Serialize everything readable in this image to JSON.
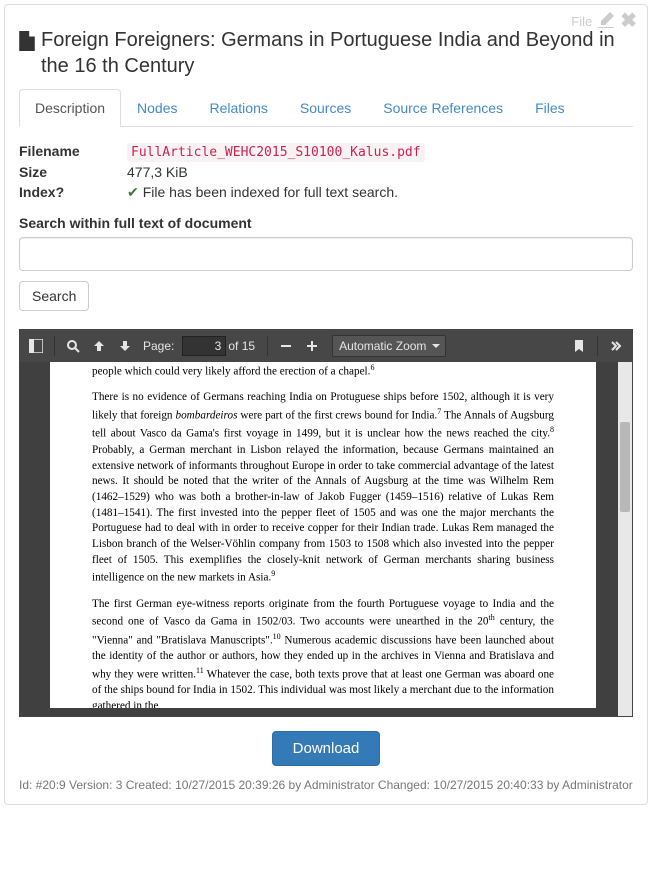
{
  "top": {
    "file_label": "File"
  },
  "title": "Foreign Foreigners: Germans in Portuguese India and Beyond in the 16 th Century",
  "tabs": [
    {
      "label": "Description",
      "active": true
    },
    {
      "label": "Nodes"
    },
    {
      "label": "Relations"
    },
    {
      "label": "Sources"
    },
    {
      "label": "Source References"
    },
    {
      "label": "Files"
    }
  ],
  "meta": {
    "filename_label": "Filename",
    "filename_value": "FullArticle_WEHC2015_S10100_Kalus.pdf",
    "size_label": "Size",
    "size_value": "477,3 KiB",
    "index_label": "Index?",
    "index_status": "File has been indexed for full text search."
  },
  "search": {
    "label": "Search within full text of document",
    "button": "Search",
    "placeholder": ""
  },
  "viewer": {
    "page_label": "Page:",
    "page_value": "3",
    "of_pages": "of 15",
    "zoom": "Automatic Zoom",
    "paragraphs": {
      "frag": "people which could very likely afford the erection of a chapel.",
      "sup0": "6",
      "p1a": "There is no evidence of Germans reaching India on Protuguese ships before 1502, although it is very likely that foreign ",
      "p1b_it": "bombardeiros",
      "p1c": " were part of the first crews bound for India.",
      "sup1": "7",
      "p1d": " The Annals of Augsburg tell about Vasco da Gama's first voyage in 1499, but it is unclear how the news reached the city.",
      "sup2": "8",
      "p1e": " Probably, a German merchant in Lisbon relayed the information, because Germans maintained an extensive network of informants throughout Europe in order to take commercial advantage of the latest news. It should be noted that the writer of the Annals of Augsburg at the time was Wilhelm Rem (1462–1529) who was both a brother-in-law of Jakob Fugger (1459–1516) relative of Lukas Rem (1481–1541). The first invested into the pepper fleet of 1505 and was one the major merchants the Portuguese had to deal with in order to receive copper for their Indian trade. Lukas Rem managed the Lisbon branch of the Welser-Vöhlin company from 1503 to 1508 which also invested into the pepper fleet of 1505. This exemplifies the closely-knit network of German merchants sharing business intelligence on the new markets in Asia.",
      "sup3": "9",
      "p2a": "The first German eye-witness reports originate from the fourth Portuguese voyage to India and the second one of Vasco da Gama in 1502/03. Two accounts were unearthed in the 20",
      "p2a_th": "th",
      "p2b": " century, the \"Vienna\" and \"Bratislava Manuscripts\".",
      "sup4": "10",
      "p2c": " Numerous academic discussions have been launched about the identity of the author or authors, how they ended up in the archives in Vienna and Bratislava and why they were written.",
      "sup5": "11",
      "p2d": " Whatever the case, both texts prove that at least one German was aboard one of the ships bound for India in 1502. This individual was most likely a merchant due to the information gathered in the"
    }
  },
  "download": "Download",
  "footer": "Id: #20:9 Version: 3 Created: 10/27/2015 20:39:26 by Administrator Changed: 10/27/2015 20:40:33 by Administrator"
}
